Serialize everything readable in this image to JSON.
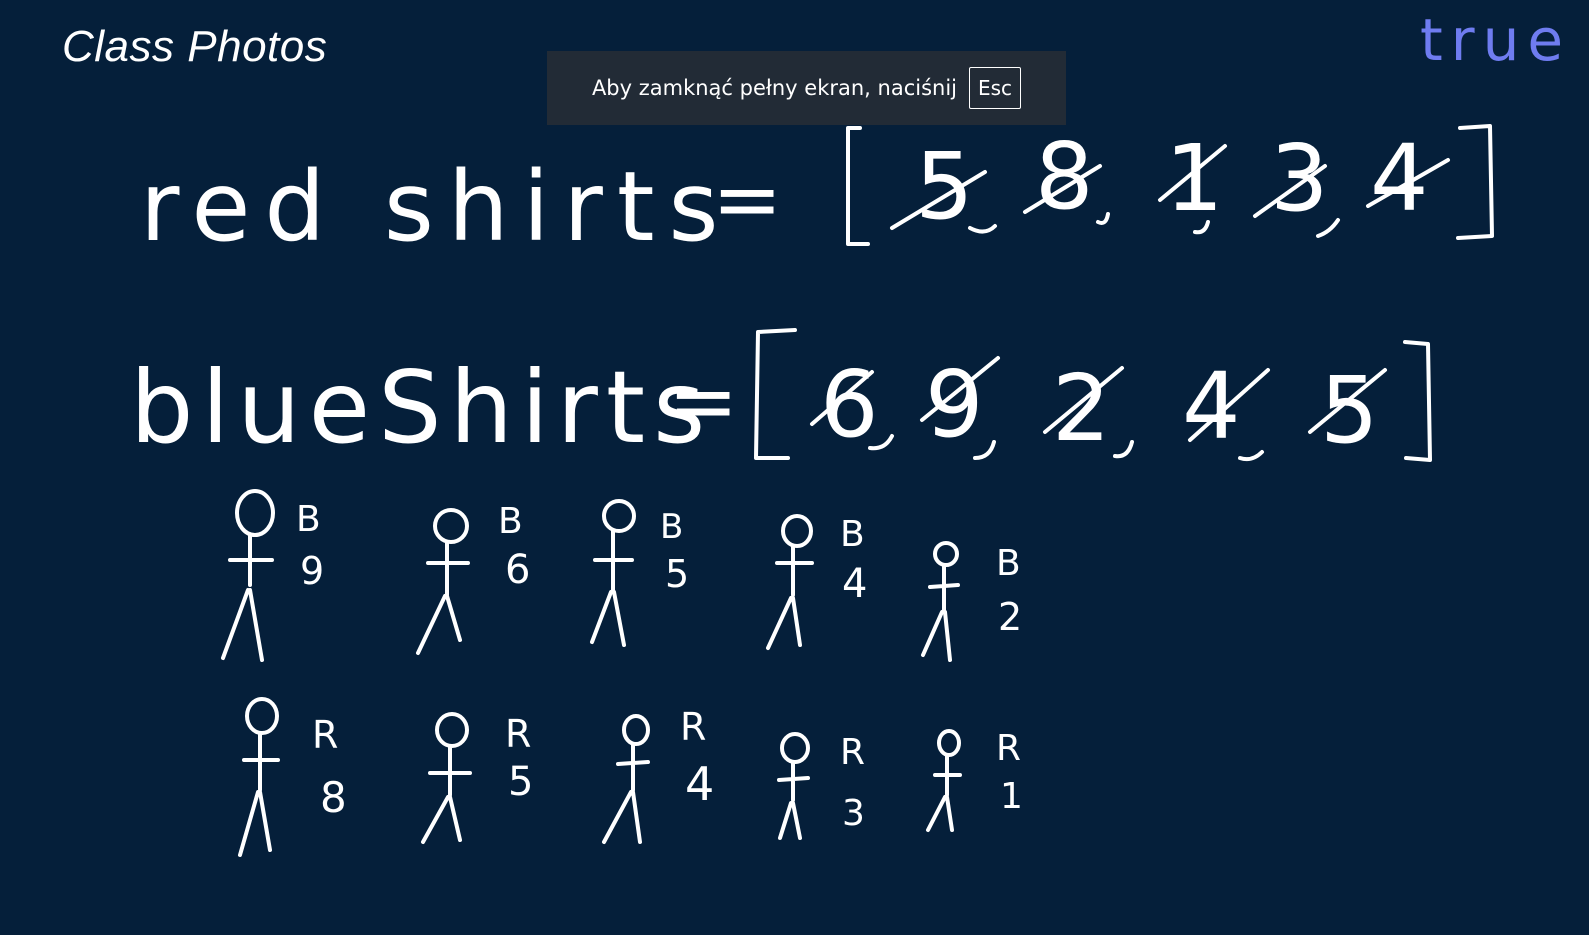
{
  "title": "Class Photos",
  "fullscreen_notice": {
    "message": "Aby zamknąć pełny ekran, naciśnij",
    "key": "Esc"
  },
  "result_label": "true",
  "red_line": {
    "label": "red shirts",
    "equals": "=",
    "values": [
      "5",
      "8",
      "1",
      "3",
      "4"
    ]
  },
  "blue_line": {
    "label": "blueShirts",
    "equals": "=",
    "values": [
      "6",
      "9",
      "2",
      "4",
      "5"
    ]
  },
  "blue_row": [
    {
      "tag": "B",
      "num": "9"
    },
    {
      "tag": "B",
      "num": "6"
    },
    {
      "tag": "B",
      "num": "5"
    },
    {
      "tag": "B",
      "num": "4"
    },
    {
      "tag": "B",
      "num": "2"
    }
  ],
  "red_row": [
    {
      "tag": "R",
      "num": "8"
    },
    {
      "tag": "R",
      "num": "5"
    },
    {
      "tag": "R",
      "num": "4"
    },
    {
      "tag": "R",
      "num": "3"
    },
    {
      "tag": "R",
      "num": "1"
    }
  ],
  "colors": {
    "background": "#051f3a",
    "ink": "#ffffff",
    "result_ink": "#6f7cf0",
    "banner": "#222b36"
  }
}
